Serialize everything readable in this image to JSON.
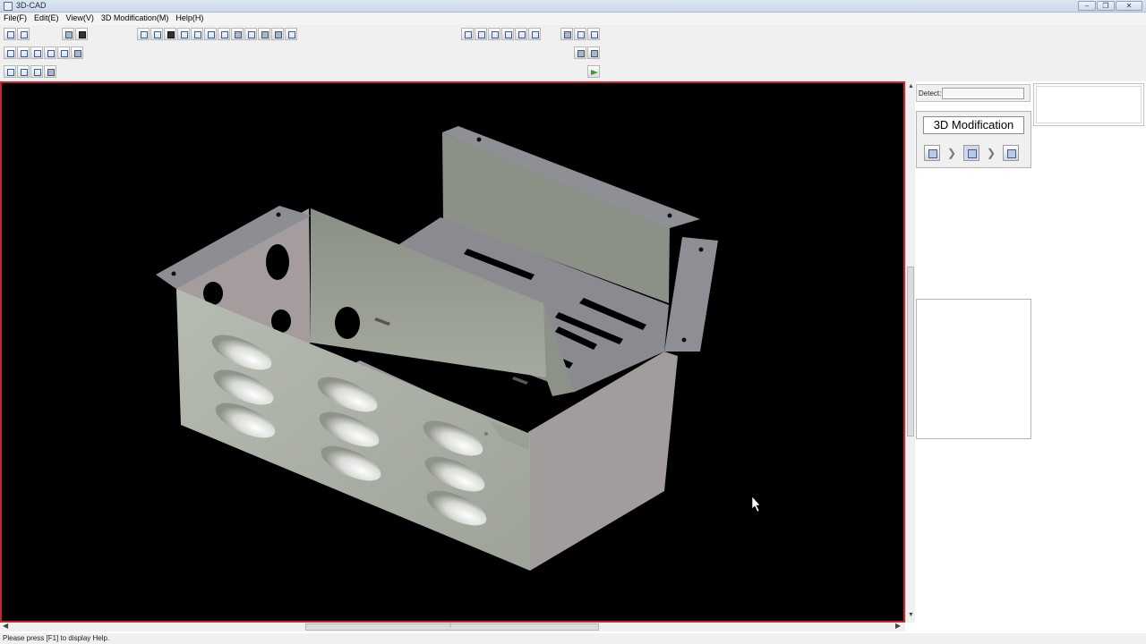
{
  "window": {
    "title": "3D-CAD",
    "controls": [
      "minimize",
      "restore",
      "close"
    ]
  },
  "menu": [
    {
      "label": "File(F)"
    },
    {
      "label": "Edit(E)"
    },
    {
      "label": "View(V)"
    },
    {
      "label": "3D Modification(M)"
    },
    {
      "label": "Help(H)"
    }
  ],
  "toolbar": {
    "row1_icons": [
      "undo-icon",
      "redo-icon",
      "open-icon",
      "save-icon",
      "view-front-icon",
      "fit-icon",
      "window-zoom-icon",
      "zoom-in-icon",
      "zoom-out-icon",
      "zoom-all-icon",
      "rotate-icon",
      "pan-icon",
      "shade-icon",
      "hide-icon",
      "layer-icon",
      "grid-icon",
      "measure-icon",
      "section-icon",
      "dimension-icon",
      "tree-icon",
      "hierarchy-icon",
      "list-icon",
      "part-icon",
      "assembly-icon",
      "properties-icon"
    ],
    "accent_color": "#2c5fa8"
  },
  "right_panel": {
    "detect_label": "Detect:",
    "detect_value": "",
    "modification_title": "3D Modification",
    "tools": [
      "edit-face-icon",
      "next-icon",
      "box-icon",
      "next-icon",
      "plane-icon"
    ]
  },
  "status": {
    "text": "Please press [F1] to display Help."
  },
  "viewport": {
    "background": "#000000",
    "border_color": "#c8262c",
    "model_color": "#a9aea6"
  }
}
